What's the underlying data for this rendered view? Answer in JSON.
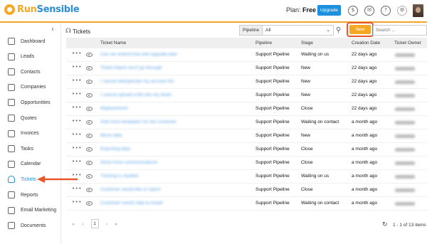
{
  "header": {
    "logo_run": "Run",
    "logo_sensible": "Sensible",
    "plan_label": "Plan:",
    "plan_value": "Free",
    "upgrade_label": "Upgrade",
    "icons": [
      "dollar-icon",
      "ticket-icon",
      "help-icon",
      "gear-icon"
    ],
    "accent_color": "#f3a52a"
  },
  "sidebar": {
    "items": [
      {
        "label": "Dashboard",
        "icon": "dashboard-icon"
      },
      {
        "label": "Leads",
        "icon": "leads-icon"
      },
      {
        "label": "Contacts",
        "icon": "contacts-icon"
      },
      {
        "label": "Companies",
        "icon": "companies-icon"
      },
      {
        "label": "Opportunities",
        "icon": "opportunities-icon"
      },
      {
        "label": "Quotes",
        "icon": "quotes-icon"
      },
      {
        "label": "Invoices",
        "icon": "invoices-icon"
      },
      {
        "label": "Tasks",
        "icon": "tasks-icon"
      },
      {
        "label": "Calendar",
        "icon": "calendar-icon"
      },
      {
        "label": "Tickets",
        "icon": "headset-icon",
        "active": true
      },
      {
        "label": "Reports",
        "icon": "reports-icon"
      },
      {
        "label": "Email Marketing",
        "icon": "email-icon"
      },
      {
        "label": "Documents",
        "icon": "documents-icon"
      }
    ]
  },
  "toolbar": {
    "title": "Tickets",
    "pipeline_label": "Pipeline",
    "pipeline_value": "All",
    "new_label": "New",
    "search_placeholder": "Search ..."
  },
  "table": {
    "columns": [
      "Ticket Name",
      "Pipeline",
      "Stage",
      "Creation Date",
      "Ticket Owner"
    ],
    "rows": [
      {
        "name": "Can we extend trial and upgrade plan",
        "pipeline": "Support Pipeline",
        "stage": "Waiting on us",
        "date": "22 days ago"
      },
      {
        "name": "Ticket import won't go through",
        "pipeline": "Support Pipeline",
        "stage": "New",
        "date": "22 days ago"
      },
      {
        "name": "I cannot deduplicate my account list",
        "pipeline": "Support Pipeline",
        "stage": "New",
        "date": "22 days ago"
      },
      {
        "name": "I cannot upload a file into my deals",
        "pipeline": "Support Pipeline",
        "stage": "New",
        "date": "22 days ago"
      },
      {
        "name": "Replacement",
        "pipeline": "Support Pipeline",
        "stage": "Close",
        "date": "22 days ago"
      },
      {
        "name": "Add more templates for the customer",
        "pipeline": "Support Pipeline",
        "stage": "Waiting on contact",
        "date": "a month ago"
      },
      {
        "name": "Move data",
        "pipeline": "Support Pipeline",
        "stage": "New",
        "date": "a month ago"
      },
      {
        "name": "Exporting data",
        "pipeline": "Support Pipeline",
        "stage": "Close",
        "date": "a month ago"
      },
      {
        "name": "Send more communications",
        "pipeline": "Support Pipeline",
        "stage": "Close",
        "date": "a month ago"
      },
      {
        "name": "Training is needed",
        "pipeline": "Support Pipeline",
        "stage": "Waiting on us",
        "date": "a month ago"
      },
      {
        "name": "Customer would like to report",
        "pipeline": "Support Pipeline",
        "stage": "Close",
        "date": "a month ago"
      },
      {
        "name": "Customer needs help to install",
        "pipeline": "Support Pipeline",
        "stage": "Waiting on contact",
        "date": "a month ago"
      }
    ]
  },
  "footer": {
    "first": "«",
    "prev": "‹",
    "page": "1",
    "next": "›",
    "last": "»",
    "range_text": "1 - 1 of 13 items"
  }
}
